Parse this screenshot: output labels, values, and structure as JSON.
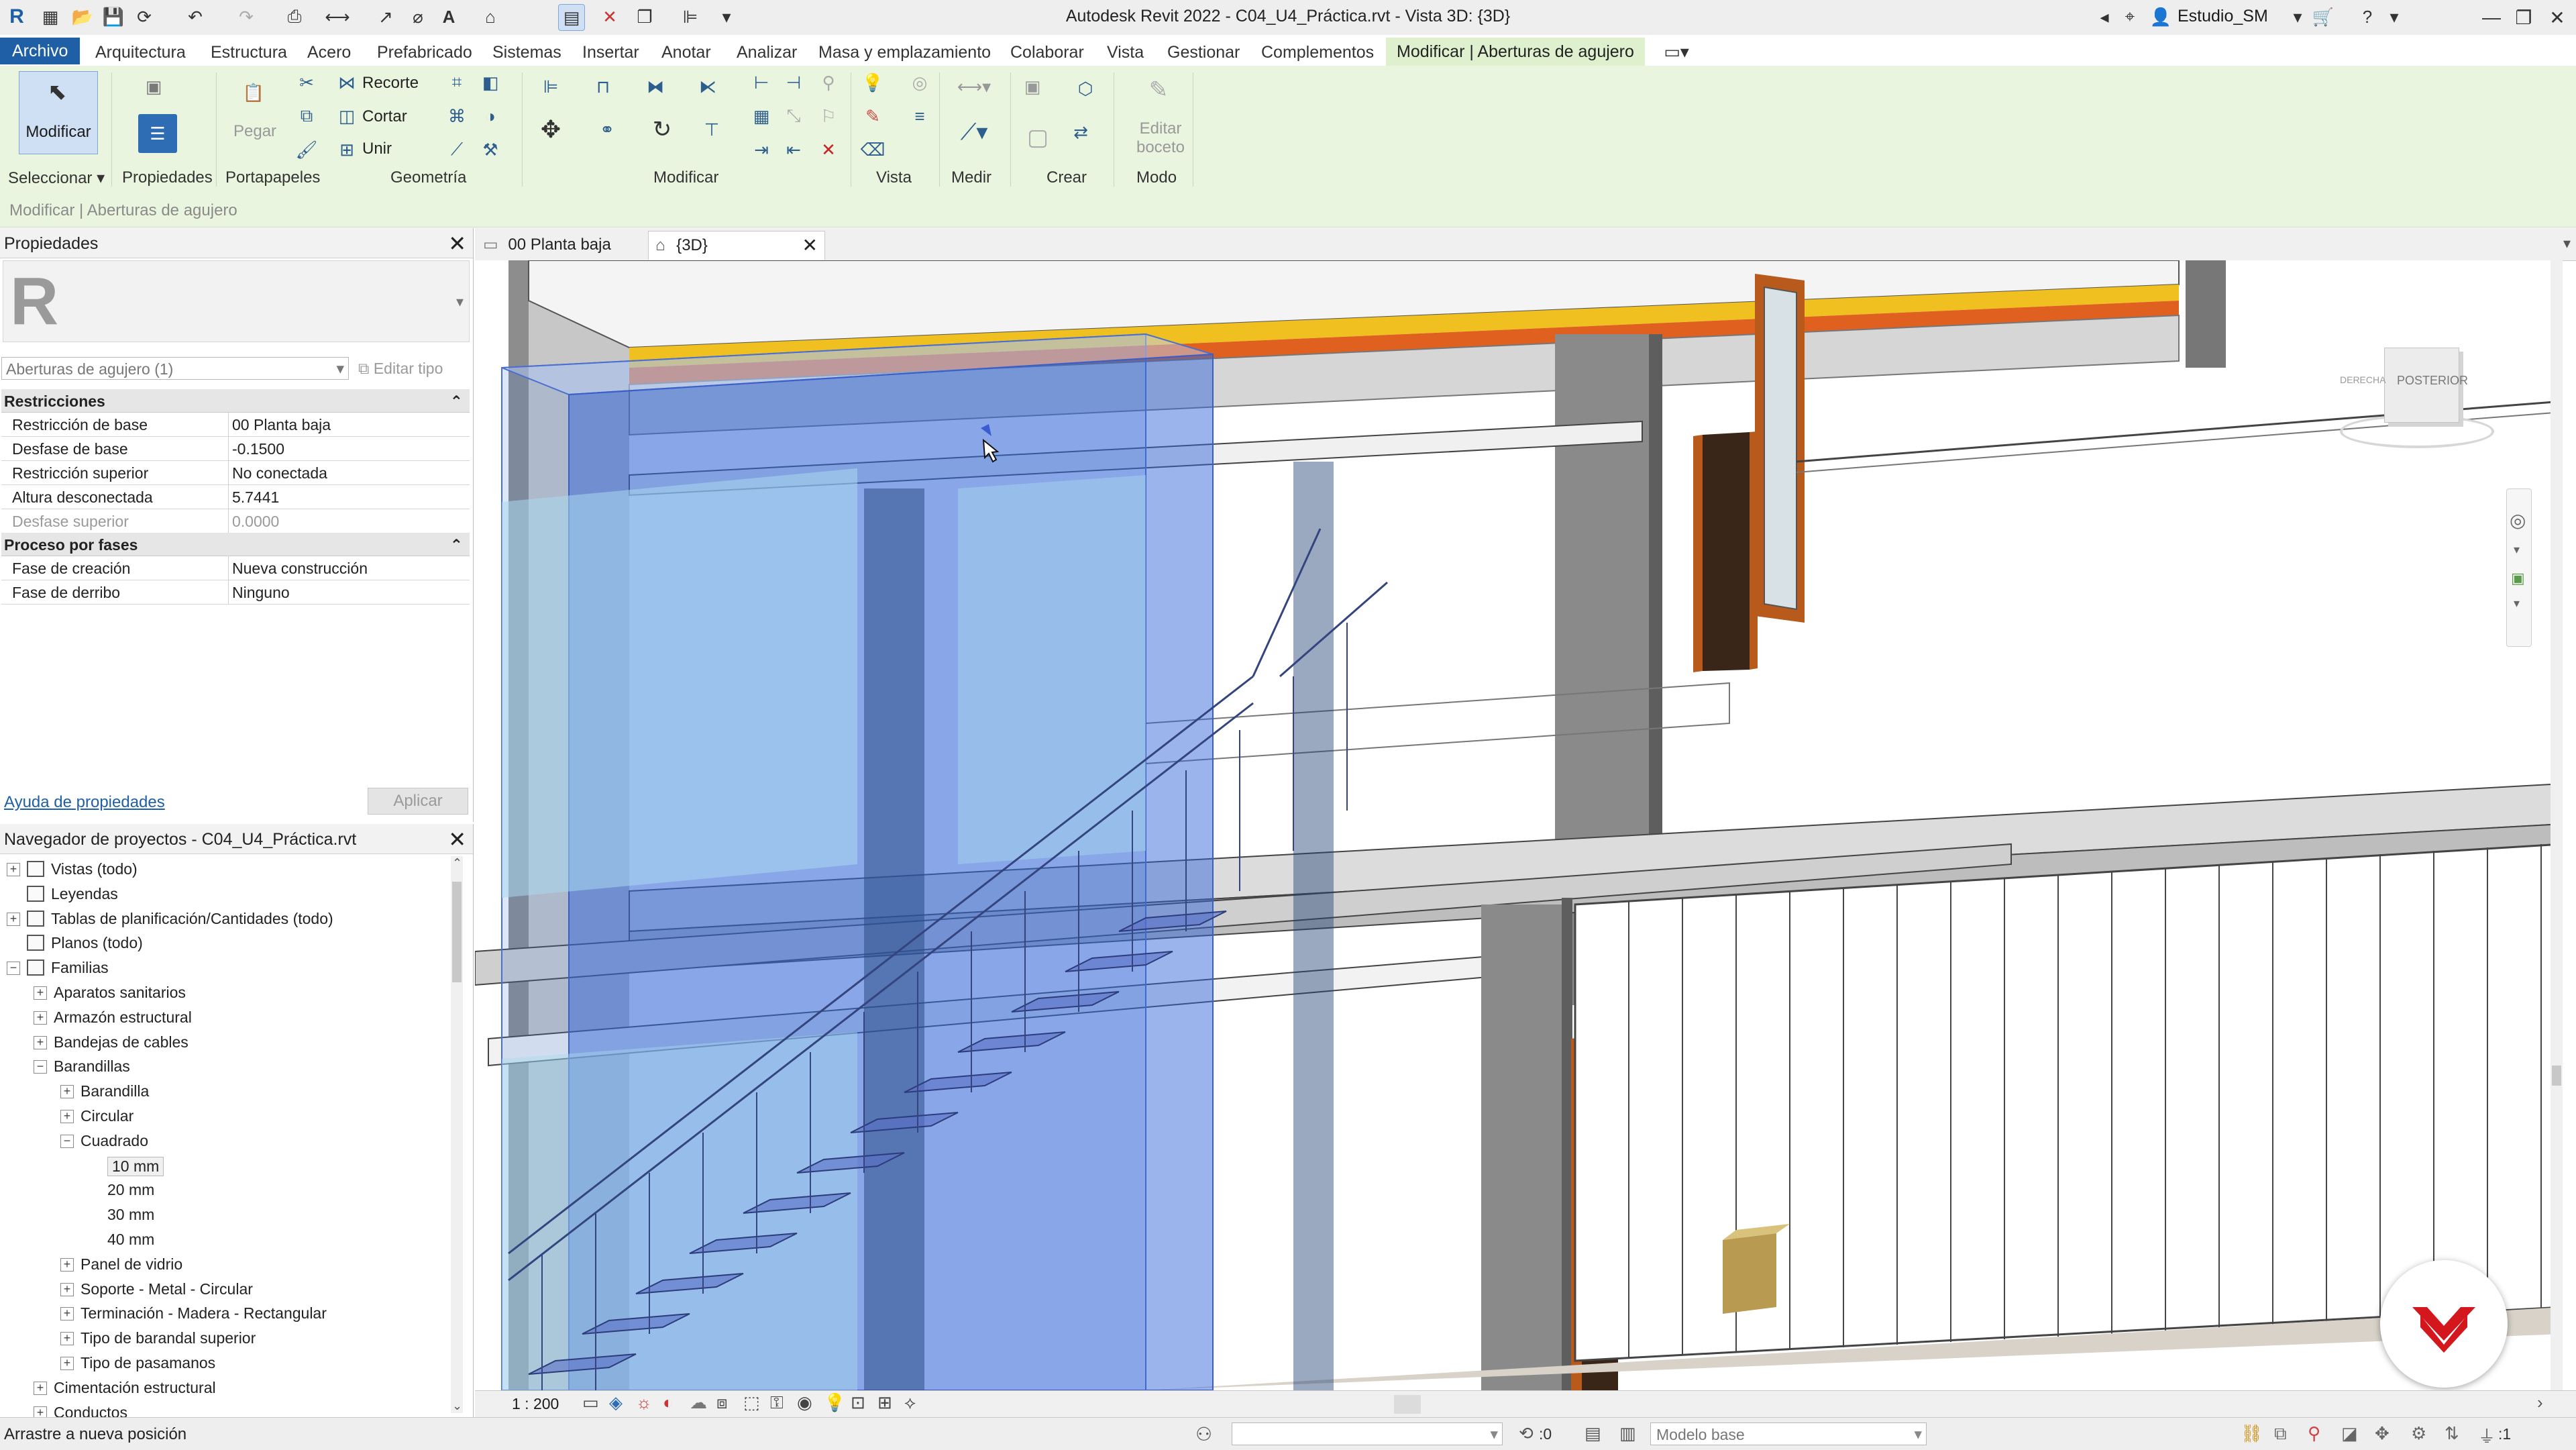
{
  "window": {
    "title": "Autodesk Revit 2022 - C04_U4_Práctica.rvt - Vista 3D: {3D}",
    "user": "Estudio_SM"
  },
  "tabs": [
    {
      "label": "Archivo"
    },
    {
      "label": "Arquitectura"
    },
    {
      "label": "Estructura"
    },
    {
      "label": "Acero"
    },
    {
      "label": "Prefabricado"
    },
    {
      "label": "Sistemas"
    },
    {
      "label": "Insertar"
    },
    {
      "label": "Anotar"
    },
    {
      "label": "Analizar"
    },
    {
      "label": "Masa y emplazamiento"
    },
    {
      "label": "Colaborar"
    },
    {
      "label": "Vista"
    },
    {
      "label": "Gestionar"
    },
    {
      "label": "Complementos"
    },
    {
      "label": "Modificar | Aberturas de agujero"
    }
  ],
  "ribbon": {
    "modify_label": "Modificar",
    "properties_label": "Propiedades",
    "paste_label": "Pegar",
    "cope_label": "Recorte",
    "cut_label": "Cortar",
    "join_label": "Unir",
    "edit_sketch_label": "Editar boceto",
    "panels": {
      "select": "Seleccionar",
      "properties": "Propiedades",
      "clipboard": "Portapapeles",
      "geometry": "Geometría",
      "modify": "Modificar",
      "view": "Vista",
      "measure": "Medir",
      "create": "Crear",
      "mode": "Modo"
    }
  },
  "option_bar": {
    "context": "Modificar | Aberturas de agujero"
  },
  "properties": {
    "title": "Propiedades",
    "type_selector": "Aberturas de agujero (1)",
    "edit_type": "Editar tipo",
    "groups": [
      {
        "name": "Restricciones",
        "rows": [
          {
            "key": "Restricción de base",
            "value": "00 Planta baja",
            "dim": false
          },
          {
            "key": "Desfase de base",
            "value": "-0.1500",
            "dim": false
          },
          {
            "key": "Restricción superior",
            "value": "No conectada",
            "dim": false
          },
          {
            "key": "Altura desconectada",
            "value": "5.7441",
            "dim": false
          },
          {
            "key": "Desfase superior",
            "value": "0.0000",
            "dim": true
          }
        ]
      },
      {
        "name": "Proceso por fases",
        "rows": [
          {
            "key": "Fase de creación",
            "value": "Nueva construcción",
            "dim": false
          },
          {
            "key": "Fase de derribo",
            "value": "Ninguno",
            "dim": false
          }
        ]
      }
    ],
    "help_link": "Ayuda de propiedades",
    "apply_label": "Aplicar"
  },
  "browser": {
    "title": "Navegador de proyectos - C04_U4_Práctica.rvt",
    "nodes": [
      {
        "label": "Vistas (todo)",
        "level": 0,
        "toggle": "+",
        "icon": true
      },
      {
        "label": "Leyendas",
        "level": 0,
        "toggle": "",
        "icon": true
      },
      {
        "label": "Tablas de planificación/Cantidades (todo)",
        "level": 0,
        "toggle": "+",
        "icon": true
      },
      {
        "label": "Planos (todo)",
        "level": 0,
        "toggle": "",
        "icon": true
      },
      {
        "label": "Familias",
        "level": 0,
        "toggle": "−",
        "icon": true
      },
      {
        "label": "Aparatos sanitarios",
        "level": 1,
        "toggle": "+",
        "icon": false
      },
      {
        "label": "Armazón estructural",
        "level": 1,
        "toggle": "+",
        "icon": false
      },
      {
        "label": "Bandejas de cables",
        "level": 1,
        "toggle": "+",
        "icon": false
      },
      {
        "label": "Barandillas",
        "level": 1,
        "toggle": "−",
        "icon": false
      },
      {
        "label": "Barandilla",
        "level": 2,
        "toggle": "+",
        "icon": false
      },
      {
        "label": "Circular",
        "level": 2,
        "toggle": "+",
        "icon": false
      },
      {
        "label": "Cuadrado",
        "level": 2,
        "toggle": "−",
        "icon": false
      },
      {
        "label": "10 mm",
        "level": 3,
        "toggle": "",
        "icon": false,
        "selected": true
      },
      {
        "label": "20 mm",
        "level": 3,
        "toggle": "",
        "icon": false
      },
      {
        "label": "30 mm",
        "level": 3,
        "toggle": "",
        "icon": false
      },
      {
        "label": "40 mm",
        "level": 3,
        "toggle": "",
        "icon": false
      },
      {
        "label": "Panel de vidrio",
        "level": 2,
        "toggle": "+",
        "icon": false
      },
      {
        "label": "Soporte - Metal - Circular",
        "level": 2,
        "toggle": "+",
        "icon": false
      },
      {
        "label": "Terminación - Madera - Rectangular",
        "level": 2,
        "toggle": "+",
        "icon": false
      },
      {
        "label": "Tipo de barandal superior",
        "level": 2,
        "toggle": "+",
        "icon": false
      },
      {
        "label": "Tipo de pasamanos",
        "level": 2,
        "toggle": "+",
        "icon": false
      },
      {
        "label": "Cimentación estructural",
        "level": 1,
        "toggle": "+",
        "icon": false
      },
      {
        "label": "Conductos",
        "level": 1,
        "toggle": "+",
        "icon": false
      }
    ]
  },
  "view_tabs": [
    {
      "label": "00 Planta baja",
      "active": false
    },
    {
      "label": "{3D}",
      "active": true
    }
  ],
  "viewcube": {
    "face_back": "POSTERIOR",
    "face_right": "DERECHA"
  },
  "view_control": {
    "scale": "1 : 200"
  },
  "status": {
    "message": "Arrastre a nueva posición",
    "workset_value": ":0",
    "design_option": "Modelo base",
    "filter_count": ":1"
  },
  "colors": {
    "accent": "#1f5fa6",
    "ribbon_bg": "#eaf5e0",
    "opening_selection": "#5b8ee6",
    "door_frame": "#b85a1c"
  }
}
